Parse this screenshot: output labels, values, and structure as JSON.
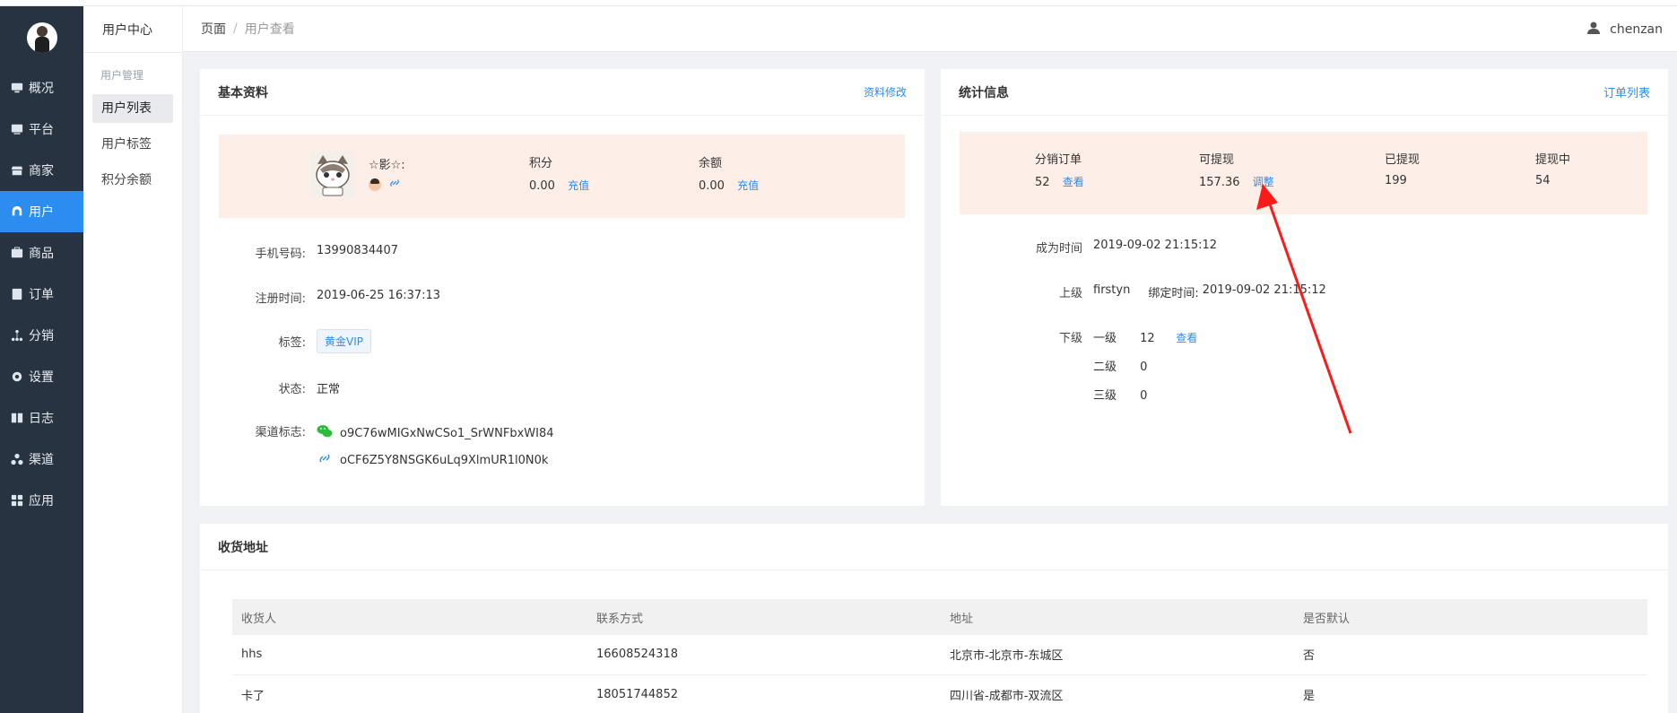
{
  "sidebar": {
    "items": [
      {
        "label": "概况",
        "icon": "dashboard-icon"
      },
      {
        "label": "平台",
        "icon": "monitor-icon"
      },
      {
        "label": "商家",
        "icon": "store-icon"
      },
      {
        "label": "用户",
        "icon": "user-icon",
        "active": true
      },
      {
        "label": "商品",
        "icon": "goods-icon"
      },
      {
        "label": "订单",
        "icon": "order-icon"
      },
      {
        "label": "分销",
        "icon": "distribution-icon"
      },
      {
        "label": "设置",
        "icon": "gear-icon"
      },
      {
        "label": "日志",
        "icon": "log-icon"
      },
      {
        "label": "渠道",
        "icon": "channel-icon"
      },
      {
        "label": "应用",
        "icon": "apps-icon"
      }
    ]
  },
  "subsidebar": {
    "title": "用户中心",
    "group": "用户管理",
    "items": [
      "用户列表",
      "用户标签",
      "积分余额"
    ]
  },
  "header": {
    "breadcrumb_root": "页面",
    "breadcrumb_sep": "/",
    "breadcrumb_current": "用户查看",
    "username": "chenzan"
  },
  "basic": {
    "title": "基本资料",
    "edit_link": "资料修改",
    "nickname": "☆影☆:",
    "points_label": "积分",
    "points_value": "0.00",
    "points_action": "充值",
    "balance_label": "余额",
    "balance_value": "0.00",
    "balance_action": "充值",
    "phone_label": "手机号码:",
    "phone_value": "13990834407",
    "register_label": "注册时间:",
    "register_value": "2019-06-25 16:37:13",
    "tag_label": "标签:",
    "tag_value": "黄金VIP",
    "status_label": "状态:",
    "status_value": "正常",
    "channel_label": "渠道标志:",
    "channel_wechat": "o9C76wMIGxNwCSo1_SrWNFbxWI84",
    "channel_mini": "oCF6Z5Y8NSGK6uLq9XlmUR1l0N0k"
  },
  "stats": {
    "title": "统计信息",
    "order_list_link": "订单列表",
    "dist_orders_label": "分销订单",
    "dist_orders_value": "52",
    "dist_orders_action": "查看",
    "withdrawable_label": "可提现",
    "withdrawable_value": "157.36",
    "withdrawable_action": "调整",
    "withdrawn_label": "已提现",
    "withdrawn_value": "199",
    "withdrawing_label": "提现中",
    "withdrawing_value": "54",
    "become_label": "成为时间",
    "become_value": "2019-09-02 21:15:12",
    "parent_label": "上级",
    "parent_value": "firstyn",
    "bind_label": "绑定时间:",
    "bind_value": "2019-09-02 21:15:12",
    "children_label": "下级",
    "levels": [
      {
        "name": "一级",
        "count": "12",
        "action": "查看"
      },
      {
        "name": "二级",
        "count": "0"
      },
      {
        "name": "三级",
        "count": "0"
      }
    ]
  },
  "address": {
    "title": "收货地址",
    "columns": [
      "收货人",
      "联系方式",
      "地址",
      "是否默认"
    ],
    "rows": [
      [
        "hhs",
        "16608524318",
        "北京市-北京市-东城区",
        "否"
      ],
      [
        "卡了",
        "18051744852",
        "四川省-成都市-双流区",
        "是"
      ]
    ]
  },
  "colors": {
    "sidebar_bg": "#273341",
    "accent": "#2d8cf0",
    "strip_bg": "#fdeee7",
    "annotation": "#ff1a1a"
  }
}
